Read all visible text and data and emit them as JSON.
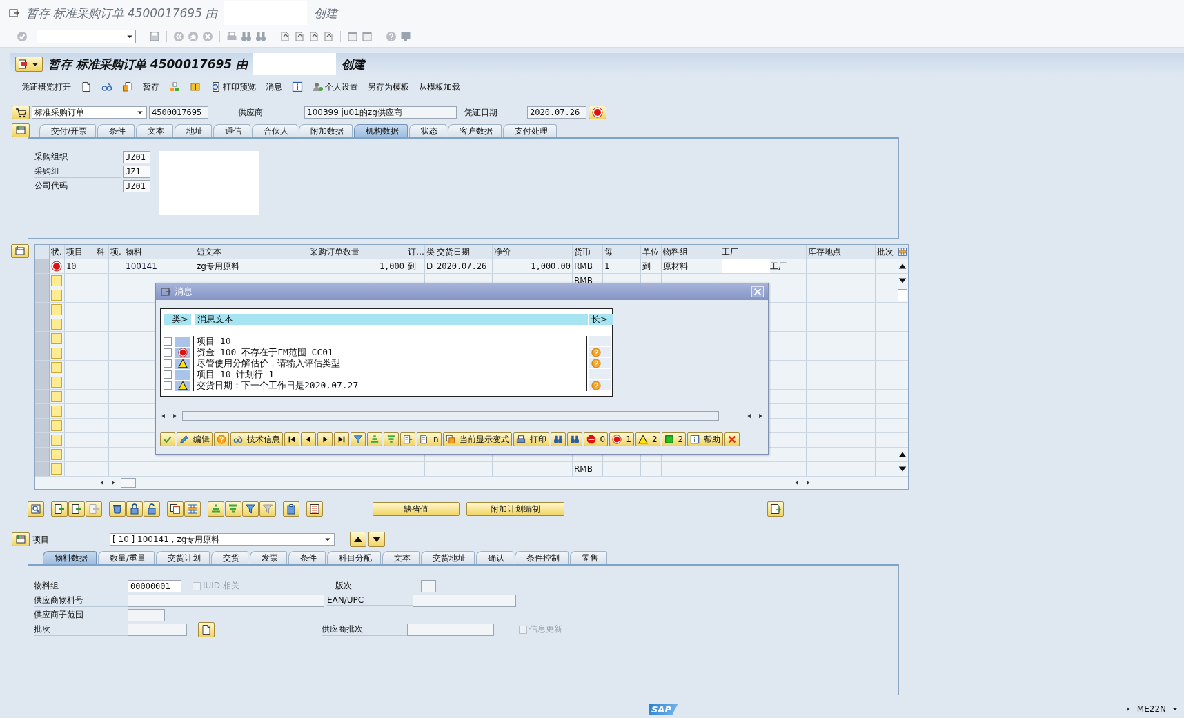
{
  "window": {
    "title_prefix": "暂存 标准采购订单 4500017695 由",
    "title_suffix": "创建"
  },
  "screen_title": {
    "prefix": "暂存 标准采购订单 4500017695 由",
    "suffix": "创建"
  },
  "app_toolbar": [
    {
      "kind": "text",
      "label": "凭证概览打开"
    },
    {
      "kind": "new-doc"
    },
    {
      "kind": "display-change"
    },
    {
      "kind": "other-doc"
    },
    {
      "kind": "text",
      "label": "暂存"
    },
    {
      "kind": "check-tree"
    },
    {
      "kind": "msg-print"
    },
    {
      "kind": "print-preview",
      "label": "打印预览"
    },
    {
      "kind": "text",
      "label": "消息"
    },
    {
      "kind": "info"
    },
    {
      "kind": "settings",
      "label": "个人设置"
    },
    {
      "kind": "text",
      "label": "另存为模板"
    },
    {
      "kind": "text",
      "label": "从模板加载"
    }
  ],
  "header": {
    "doc_type": "标准采购订单",
    "doc_number": "4500017695",
    "vendor_label": "供应商",
    "vendor": "100399 ju01的zg供应商",
    "date_label": "凭证日期",
    "date": "2020.07.26",
    "error": true
  },
  "header_tabs": [
    {
      "label": "交付/开票",
      "selected": false
    },
    {
      "label": "条件",
      "selected": false
    },
    {
      "label": "文本",
      "selected": false
    },
    {
      "label": "地址",
      "selected": false
    },
    {
      "label": "通信",
      "selected": false
    },
    {
      "label": "合伙人",
      "selected": false
    },
    {
      "label": "附加数据",
      "selected": false
    },
    {
      "label": "机构数据",
      "selected": true
    },
    {
      "label": "状态",
      "selected": false
    },
    {
      "label": "客户数据",
      "selected": false
    },
    {
      "label": "支付处理",
      "selected": false
    }
  ],
  "org_data": [
    {
      "label": "采购组织",
      "value": "JZ01"
    },
    {
      "label": "采购组",
      "value": "JZ1"
    },
    {
      "label": "公司代码",
      "value": "JZ01"
    }
  ],
  "items_table": {
    "columns": [
      "状.",
      "项目",
      "科",
      "项.",
      "物料",
      "短文本",
      "采购订单数量",
      "订…",
      "类",
      "交货日期",
      "净价",
      "货币",
      "每",
      "单位",
      "物料组",
      "工厂",
      "库存地点",
      "批次"
    ],
    "rows": [
      {
        "kind": "error",
        "item": "10",
        "material": "100141",
        "short_text": "zg专用原料",
        "quantity": "1,000",
        "order_unit": "到",
        "category": "D",
        "delivery_date": "2020.07.26",
        "net_price": "1,000.00",
        "currency": "RMB",
        "per": "1",
        "unit": "到",
        "material_group": "原材料",
        "plant": "工厂"
      },
      {
        "kind": "new",
        "currency": "RMB"
      },
      {
        "kind": "new"
      },
      {
        "kind": "new"
      },
      {
        "kind": "new"
      },
      {
        "kind": "new"
      },
      {
        "kind": "new"
      },
      {
        "kind": "new"
      },
      {
        "kind": "new"
      },
      {
        "kind": "new"
      },
      {
        "kind": "new"
      },
      {
        "kind": "new"
      },
      {
        "kind": "new"
      },
      {
        "kind": "new"
      },
      {
        "kind": "new",
        "currency": "RMB"
      }
    ]
  },
  "grid_buttons": [
    "缺省值",
    "附加计划编制"
  ],
  "item_selector": {
    "label": "项目",
    "value": "[ 10 ] 100141 , zg专用原料"
  },
  "item_tabs": [
    {
      "label": "物料数据",
      "selected": true
    },
    {
      "label": "数量/重量",
      "selected": false
    },
    {
      "label": "交货计划",
      "selected": false
    },
    {
      "label": "交货",
      "selected": false
    },
    {
      "label": "发票",
      "selected": false
    },
    {
      "label": "条件",
      "selected": false
    },
    {
      "label": "科目分配",
      "selected": false
    },
    {
      "label": "文本",
      "selected": false
    },
    {
      "label": "交货地址",
      "selected": false
    },
    {
      "label": "确认",
      "selected": false
    },
    {
      "label": "条件控制",
      "selected": false
    },
    {
      "label": "零售",
      "selected": false
    }
  ],
  "material_data": {
    "material_group": {
      "label": "物料组",
      "value": "00000001"
    },
    "iuid": {
      "label": "IUID 相关",
      "checked": false,
      "disabled": true
    },
    "revision": {
      "label": "版次"
    },
    "vendor_material": {
      "label": "供应商物料号"
    },
    "ean": {
      "label": "EAN/UPC"
    },
    "vendor_subrange": {
      "label": "供应商子范围"
    },
    "batch": {
      "label": "批次"
    },
    "vendor_batch": {
      "label": "供应商批次"
    },
    "info_update": {
      "label": "信息更新",
      "checked": false,
      "disabled": true
    }
  },
  "dialog": {
    "title": "消息",
    "columns": [
      "类>",
      "消息文本",
      "长>"
    ],
    "messages": [
      {
        "kind": "header",
        "text": "项目 10",
        "checked": false,
        "long_text": false
      },
      {
        "kind": "error",
        "text": "资金 100 不存在于FM范围 CC01",
        "checked": false,
        "long_text": true
      },
      {
        "kind": "warning",
        "text": "尽管使用分解估价，请输入评估类型",
        "checked": false,
        "long_text": true
      },
      {
        "kind": "header",
        "text": "项目 10 计划行 1",
        "checked": false,
        "long_text": false
      },
      {
        "kind": "warning",
        "text": "交货日期：下一个工作日是2020.07.27",
        "checked": false,
        "long_text": true
      }
    ],
    "toolbar": [
      {
        "kind": "confirm"
      },
      {
        "kind": "edit",
        "label": "编辑"
      },
      {
        "kind": "help"
      },
      {
        "kind": "tech-info",
        "label": "技术信息"
      },
      {
        "kind": "first"
      },
      {
        "kind": "prev"
      },
      {
        "kind": "next"
      },
      {
        "kind": "last"
      },
      {
        "kind": "filter"
      },
      {
        "kind": "sort-up"
      },
      {
        "kind": "sort-down"
      },
      {
        "kind": "export"
      },
      {
        "kind": "layout",
        "label": "n"
      },
      {
        "kind": "variant",
        "label": "当前显示变式"
      },
      {
        "kind": "print",
        "label": "打印"
      },
      {
        "kind": "find"
      },
      {
        "kind": "find-next"
      },
      {
        "kind": "stop",
        "label": "0"
      },
      {
        "kind": "error",
        "label": "1"
      },
      {
        "kind": "warning",
        "label": "2"
      },
      {
        "kind": "success",
        "label": "2"
      },
      {
        "kind": "info",
        "label": "帮助"
      },
      {
        "kind": "close"
      }
    ]
  },
  "status_bar": {
    "logo": "SAP",
    "transaction": "ME22N"
  }
}
